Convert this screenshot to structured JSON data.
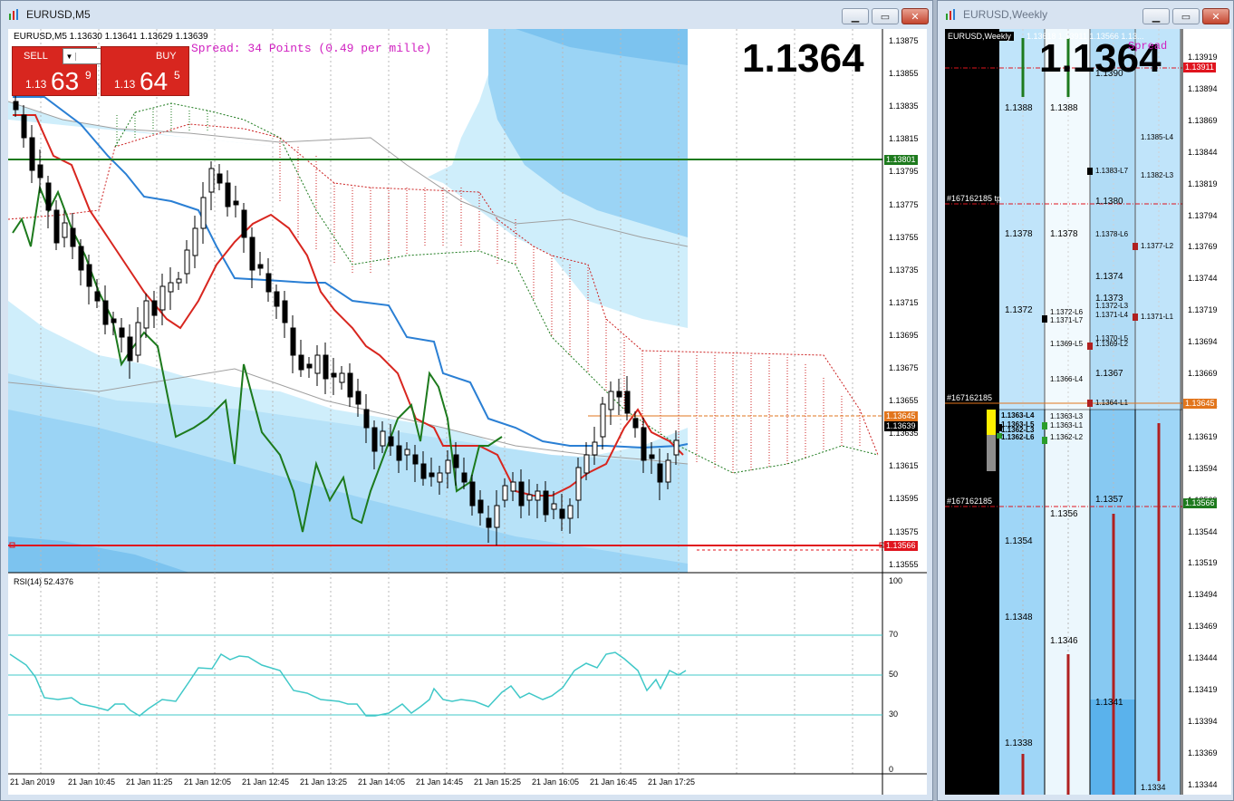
{
  "left_window": {
    "title": "EURUSD,M5",
    "info_line": "EURUSD,M5  1.13630 1.13641 1.13629 1.13639",
    "spread_text": "Spread: 34 Points (0.49 per mille)",
    "big_price": "1.1364",
    "sell_label": "SELL",
    "buy_label": "BUY",
    "lot_value": "0.30",
    "sell_prefix": "1.13",
    "sell_big": "63",
    "sell_sup": "9",
    "buy_prefix": "1.13",
    "buy_big": "64",
    "buy_sup": "5",
    "rsi_label": "RSI(14) 52.4376",
    "price_axis": [
      "1.13875",
      "1.13855",
      "1.13835",
      "1.13815",
      "1.13795",
      "1.13775",
      "1.13755",
      "1.13735",
      "1.13715",
      "1.13695",
      "1.13675",
      "1.13655",
      "1.13635",
      "1.13615",
      "1.13595",
      "1.13575",
      "1.13555"
    ],
    "price_badges": {
      "green_line": "1.13801",
      "ask": "1.13645",
      "bid": "1.13639",
      "red_line": "1.13566"
    },
    "rsi_axis": [
      "100",
      "70",
      "50",
      "30",
      "0"
    ],
    "time_axis": [
      "21 Jan 2019",
      "21 Jan 10:45",
      "21 Jan 11:25",
      "21 Jan 12:05",
      "21 Jan 12:45",
      "21 Jan 13:25",
      "21 Jan 14:05",
      "21 Jan 14:45",
      "21 Jan 15:25",
      "21 Jan 16:05",
      "21 Jan 16:45",
      "21 Jan 17:25"
    ]
  },
  "right_window": {
    "title": "EURUSD,Weekly",
    "header_symbol": "EURUSD,Weekly",
    "header_values": "1.13618 1.13911 1.13566 1.13...",
    "big_price": "1.1364",
    "spread_fragment": "Spread",
    "price_axis": [
      "1.13919",
      "1.13894",
      "1.13869",
      "1.13844",
      "1.13819",
      "1.13794",
      "1.13769",
      "1.13744",
      "1.13719",
      "1.13694",
      "1.13669",
      "1.13644",
      "1.13619",
      "1.13594",
      "1.13569",
      "1.13544",
      "1.13519",
      "1.13494",
      "1.13469",
      "1.13444",
      "1.13419",
      "1.13394",
      "1.13369",
      "1.13344"
    ],
    "price_badges": {
      "top": "1.13911",
      "mid": "1.13645",
      "low": "1.13566"
    },
    "order_labels": {
      "tp": "#167162185 tp",
      "open": "#167162185",
      "sl": "#167162185"
    },
    "col1_levels": [
      "1.1388",
      "1.1378",
      "1.1372",
      "1.1354",
      "1.1348",
      "1.1338"
    ],
    "col2_levels": [
      "1.1388",
      "1.1378",
      "1.1356",
      "1.1346"
    ],
    "col2_small": [
      "1.1372-L6",
      "1.1371-L7",
      "1.1369-L5",
      "1.1366-L4",
      "1.1363-L3",
      "1.1363-L1",
      "1.1362-L2"
    ],
    "col3_levels": [
      "1.1390",
      "1.1380",
      "1.1374",
      "1.1373",
      "1.1367",
      "1.1357",
      "1.1341"
    ],
    "col3_small": [
      "1.1383-L7",
      "1.1378-L6",
      "1.1372-L3",
      "1.1371-L4",
      "1.1370-L5",
      "1.1369-L2",
      "1.1364-L1"
    ],
    "col4_small": [
      "1.1385-L4",
      "1.1382-L3",
      "1.1377-L2",
      "1.1371-L1"
    ],
    "col0_small": [
      "1.1363-L4",
      "1.1363-L5",
      "1.1362-L3",
      "1.1362-L6"
    ],
    "col4_bottom": "1.1334"
  },
  "colors": {
    "red": "#d8261f",
    "green": "#1d7a1d",
    "blue": "#2a7fd4",
    "rsi": "#40c8c8",
    "spread": "#d020c0"
  }
}
